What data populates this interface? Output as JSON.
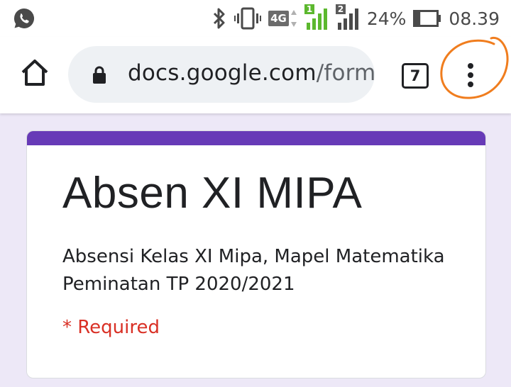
{
  "status_bar": {
    "notification_icon": "whatsapp-icon",
    "icons": [
      "bluetooth-icon",
      "vibrate-icon",
      "4g-icon",
      "signal-sim1-icon",
      "signal-sim2-icon"
    ],
    "network_label": "4G",
    "sim1_label": "1",
    "sim2_label": "2",
    "battery_percent": "24%",
    "battery_level": 0.24,
    "time": "08.39"
  },
  "browser": {
    "url_domain": "docs.google.com",
    "url_path": "/form",
    "tab_count": "7",
    "menu_icon": "more-vert-icon",
    "annotation_color": "#f07d1e"
  },
  "form": {
    "accent_color": "#673ab7",
    "title": "Absen XI MIPA",
    "description": "Absensi Kelas XI Mipa, Mapel Matematika Peminatan TP 2020/2021",
    "required_note": "* Required"
  }
}
